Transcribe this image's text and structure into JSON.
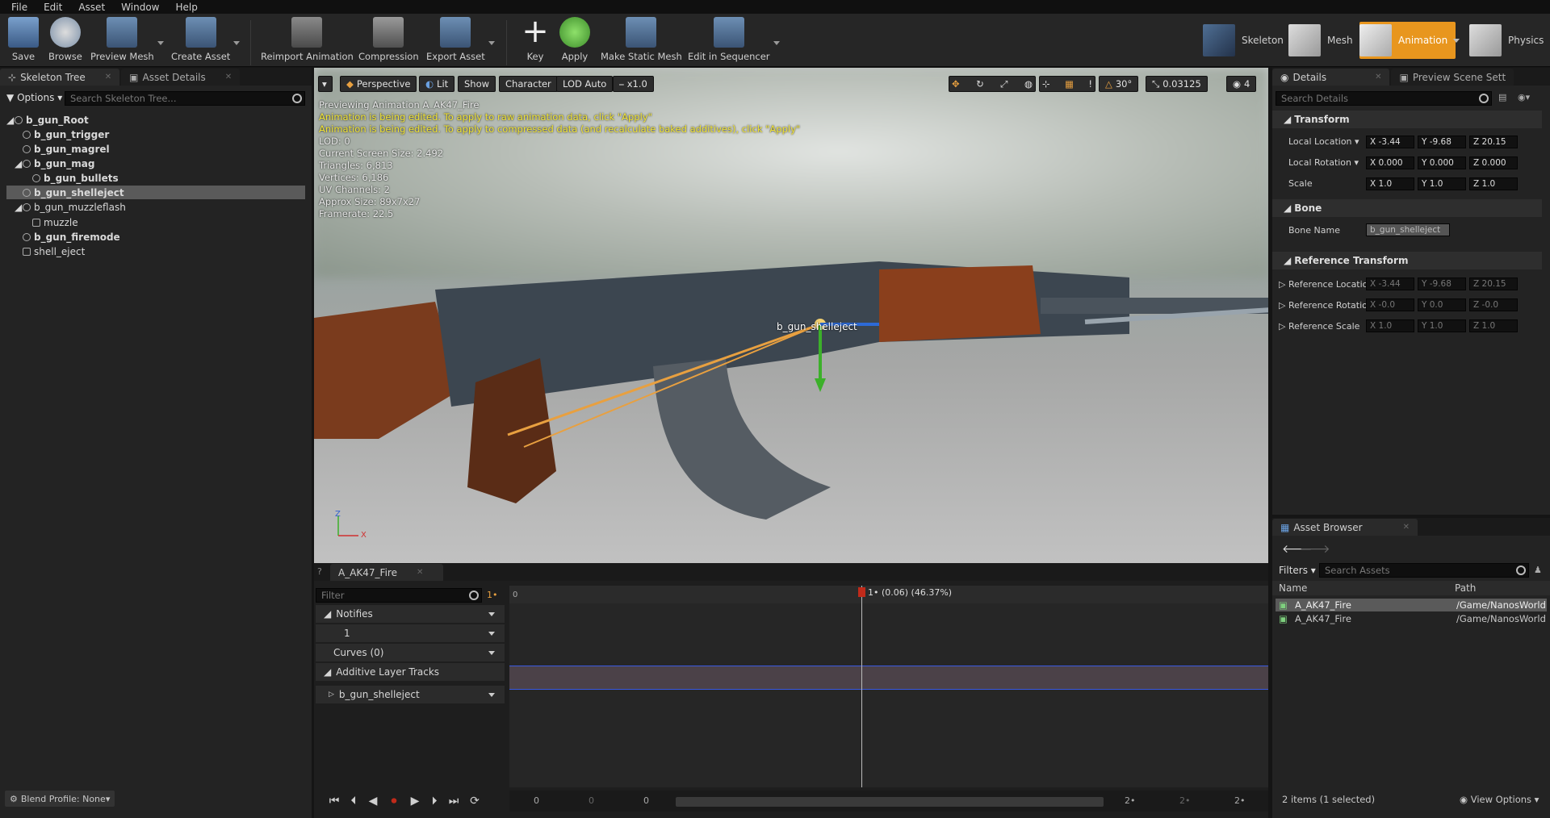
{
  "menu": [
    "File",
    "Edit",
    "Asset",
    "Window",
    "Help"
  ],
  "toolbar": {
    "save": "Save",
    "browse": "Browse",
    "preview_mesh": "Preview Mesh",
    "create_asset": "Create Asset",
    "reimport": "Reimport Animation",
    "compression": "Compression",
    "export": "Export Asset",
    "key": "Key",
    "apply": "Apply",
    "make_static": "Make Static Mesh",
    "sequencer": "Edit in Sequencer"
  },
  "modes": {
    "skeleton": "Skeleton",
    "mesh": "Mesh",
    "animation": "Animation",
    "physics": "Physics"
  },
  "left": {
    "tabs": [
      "Skeleton Tree",
      "Asset Details"
    ],
    "options": "Options",
    "search_placeholder": "Search Skeleton Tree...",
    "bones": [
      "b_gun_Root",
      "b_gun_trigger",
      "b_gun_magrel",
      "b_gun_mag",
      "b_gun_bullets",
      "b_gun_shelleject",
      "b_gun_muzzleflash",
      "muzzle",
      "b_gun_firemode",
      "shell_eject"
    ],
    "blend_profile": "Blend Profile: None"
  },
  "viewport": {
    "perspective": "Perspective",
    "lit": "Lit",
    "show": "Show",
    "character": "Character",
    "lod": "LOD Auto",
    "speed": "x1.0",
    "angle": "30°",
    "scale": "0.03125",
    "cam": "4",
    "info": [
      "Previewing Animation A_AK47_Fire",
      "Animation is being edited. To apply to raw animation data, click \"Apply\"",
      "Animation is being edited. To apply to compressed data (and recalculate baked additives), click \"Apply\"",
      "LOD: 0",
      "Current Screen Size: 2.492",
      "Triangles: 6,813",
      "Vertices: 6,186",
      "UV Channels: 2",
      "Approx Size: 89x7x27",
      "Framerate: 22.5"
    ],
    "bone_label": "b_gun_shelleject",
    "axis_z": "Z",
    "axis_x": "X"
  },
  "timeline": {
    "tab": "A_AK47_Fire",
    "filter_placeholder": "Filter",
    "frame_marker": "1•",
    "start": "0",
    "playhead": "1• (0.06) (46.37%)",
    "playhead_pct": 0.4637,
    "tracks": {
      "notifies": "Notifies",
      "n1": "1",
      "curves": "Curves",
      "curves_count": "(0)",
      "additive": "Additive Layer Tracks",
      "bone_track": "b_gun_shelleject"
    },
    "bottom": [
      "0",
      "0",
      "0",
      "2•",
      "2•",
      "2•"
    ]
  },
  "details": {
    "tabs": [
      "Details",
      "Preview Scene Sett"
    ],
    "search_placeholder": "Search Details",
    "transform": "Transform",
    "local_location": "Local Location",
    "loc": [
      "X -3.44",
      "Y -9.68",
      "Z 20.15"
    ],
    "local_rotation": "Local Rotation",
    "rot": [
      "X 0.000",
      "Y 0.000",
      "Z 0.000"
    ],
    "scale": "Scale",
    "scl": [
      "X 1.0",
      "Y 1.0",
      "Z 1.0"
    ],
    "bone": "Bone",
    "bone_name_label": "Bone Name",
    "bone_name": "b_gun_shelleject",
    "reference": "Reference Transform",
    "ref_location": "Reference Locatior",
    "rloc": [
      "X -3.44",
      "Y -9.68",
      "Z 20.15"
    ],
    "ref_rotation": "Reference Rotatior",
    "rrot": [
      "X -0.0",
      "Y 0.0",
      "Z -0.0"
    ],
    "ref_scale": "Reference Scale",
    "rscl": [
      "X 1.0",
      "Y 1.0",
      "Z 1.0"
    ]
  },
  "asset_browser": {
    "tab": "Asset Browser",
    "filters": "Filters",
    "search_placeholder": "Search Assets",
    "col_name": "Name",
    "col_path": "Path",
    "rows": [
      {
        "name": "A_AK47_Fire",
        "path": "/Game/NanosWorld"
      },
      {
        "name": "A_AK47_Fire",
        "path": "/Game/NanosWorld"
      }
    ],
    "count": "2 items (1 selected)",
    "view_options": "View Options"
  }
}
